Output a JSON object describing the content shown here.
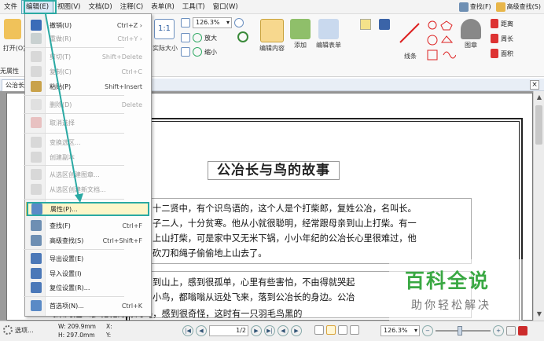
{
  "menubar": {
    "items": [
      "文件",
      "编辑(E)",
      "视图(V)",
      "文档(D)",
      "注释(C)",
      "表单(R)",
      "工具(T)",
      "窗口(W)"
    ],
    "right_items": [
      "查找(F)",
      "高级查找(S)"
    ]
  },
  "ribbon": {
    "open_label": "打开(O)",
    "zoom_value": "126.3%",
    "zoom_in": "放大",
    "zoom_out": "缩小",
    "actual_size": "实际大小",
    "edit_content": "编辑内容",
    "add": "添加",
    "edit_form": "编辑表单",
    "lines": "线条",
    "stamp": "图章",
    "distance": "距离",
    "perimeter": "周长",
    "area": "面积",
    "property_bar": "无属性"
  },
  "tab": {
    "label": "公治长"
  },
  "edit_menu": {
    "items": [
      {
        "label": "撤销(U)",
        "shortcut": "Ctrl+Z",
        "disabled": false,
        "submenu": true
      },
      {
        "label": "重做(R)",
        "shortcut": "Ctrl+Y",
        "disabled": true,
        "submenu": true
      },
      {
        "label": "剪切(T)",
        "shortcut": "Shift+Delete",
        "disabled": true
      },
      {
        "label": "复制(C)",
        "shortcut": "Ctrl+C",
        "disabled": true
      },
      {
        "label": "粘贴(P)",
        "shortcut": "Shift+Insert",
        "disabled": false
      },
      {
        "label": "删除(D)",
        "shortcut": "Delete",
        "disabled": true
      },
      {
        "label": "取消选择",
        "shortcut": "",
        "disabled": true
      },
      {
        "label": "变换选区...",
        "shortcut": "",
        "disabled": true
      },
      {
        "label": "创建副本",
        "shortcut": "",
        "disabled": true
      },
      {
        "label": "从选区创建图章...",
        "shortcut": "",
        "disabled": true
      },
      {
        "label": "从选区创建新文档...",
        "shortcut": "",
        "disabled": true
      },
      {
        "label": "属性(P)...",
        "shortcut": "",
        "disabled": false,
        "highlighted": true
      },
      {
        "label": "查找(F)",
        "shortcut": "Ctrl+F",
        "disabled": false
      },
      {
        "label": "高级查找(S)",
        "shortcut": "Ctrl+Shift+F",
        "disabled": false
      },
      {
        "label": "导出设置(E)",
        "shortcut": "",
        "disabled": false
      },
      {
        "label": "导入设置(I)",
        "shortcut": "",
        "disabled": false
      },
      {
        "label": "复位设置(R)...",
        "shortcut": "",
        "disabled": false
      },
      {
        "label": "首选项(N)...",
        "shortcut": "Ctrl+K",
        "disabled": false
      }
    ]
  },
  "document": {
    "title": "公冶长与鸟的故事",
    "lines": [
      "十二贤中，有个识鸟语的，这个人是个打柴郎，复姓公冶，名叫长。",
      "子二人，十分贫寒。他从小就很聪明，经常跟母亲到山上打柴。有一",
      "上山打柴，可是家中又无米下锅，小小年纪的公冶长心里很难过，他",
      "砍刀和绳子偷偷地上山去了。",
      "到山上，感到很孤单，心里有些害怕，不由得就哭起",
      "小鸟，都嗡嗡从远处飞来，落到公冶长的身边。公冶",
      "飞来的这么多花花绿绿的鸟，感到很奇怪，这时有一只羽毛鸟黑的"
    ]
  },
  "status": {
    "options": "选项...",
    "width": "W: 209.9mm",
    "height": "H: 297.0mm",
    "x": "X:",
    "y": "Y:",
    "page": "1/2",
    "zoom": "126.3%"
  },
  "watermark": {
    "title": "百科全说",
    "subtitle": "助你轻松解决"
  },
  "colors": {
    "highlight": "#2aa9a3",
    "hover_bg": "#fdf6c9",
    "brand_green": "#3aa843"
  }
}
